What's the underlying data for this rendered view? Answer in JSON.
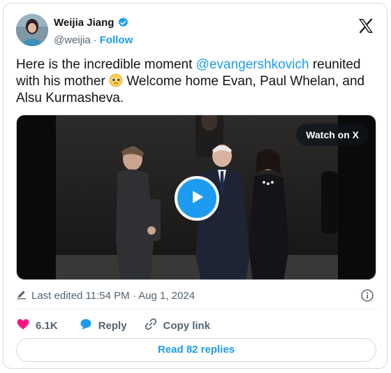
{
  "author": {
    "display_name": "Weijia Jiang",
    "handle": "@weijia",
    "separator": "·",
    "follow_label": "Follow",
    "verified_icon": "verified-badge-icon"
  },
  "tweet": {
    "text_before": "Here is the incredible moment ",
    "mention": "@evangershkovich",
    "text_after": " reunited with his mother ",
    "text_end": " Welcome home Evan, Paul Whelan, and Alsu Kurmasheva.",
    "emoji": "pleading-face-emoji"
  },
  "media": {
    "watch_label": "Watch on X",
    "play_icon": "play-icon"
  },
  "meta": {
    "edited_label": "Last edited 11:54 PM · Aug 1, 2024"
  },
  "actions": {
    "like_count": "6.1K",
    "reply_label": "Reply",
    "copy_label": "Copy link"
  },
  "footer": {
    "read_replies_label": "Read 82 replies"
  },
  "colors": {
    "accent": "#1d9bf0",
    "like": "#f91880",
    "muted": "#536471",
    "border": "#cfd9de"
  }
}
